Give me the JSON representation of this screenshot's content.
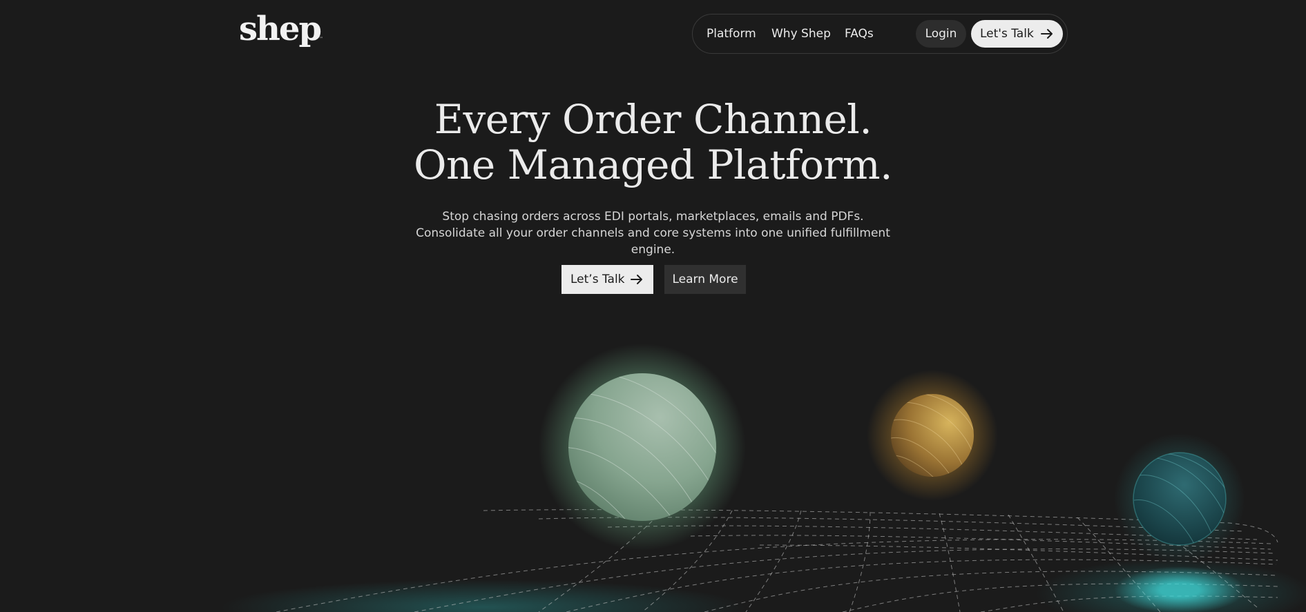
{
  "brand": {
    "logo_text": "shep",
    "logo_mark": "™"
  },
  "nav": {
    "links": [
      {
        "label": "Platform"
      },
      {
        "label": "Why Shep"
      },
      {
        "label": "FAQs"
      }
    ],
    "login_label": "Login",
    "talk_label": "Let's Talk",
    "talk_icon": "arrow-right-icon"
  },
  "hero": {
    "title_line1": "Every Order Channel.",
    "title_line2": "One Managed Platform.",
    "subtitle": "Stop chasing orders across EDI portals, marketplaces, emails and PDFs. Consolidate all your order channels and core systems into one unified fulfillment engine.",
    "primary_cta": "Let’s Talk",
    "primary_cta_icon": "arrow-right-icon",
    "secondary_cta": "Learn More"
  },
  "colors": {
    "background": "#1b1b1b",
    "text": "#ececec",
    "orb_green": "#8fb39a",
    "orb_gold": "#b58a3e",
    "orb_teal": "#1f4f55",
    "glow_teal": "#3fd6d6"
  }
}
